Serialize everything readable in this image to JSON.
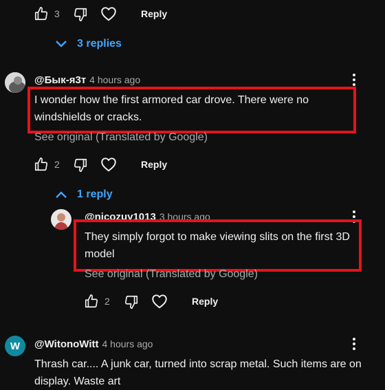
{
  "colors": {
    "background": "#0f0f0f",
    "link": "#3ea6ff",
    "highlight": "#e4131b",
    "avatar_w": "#0f8aa0"
  },
  "top_actions": {
    "like_count": "3",
    "reply_label": "Reply"
  },
  "thread1": {
    "replies_toggle": "3 replies"
  },
  "comment2": {
    "handle": "@Бык-я3т",
    "time": "4 hours ago",
    "text": "I wonder how the first armored car drove. There were no windshields or cracks.",
    "see_original": "See original (Translated by Google)",
    "like_count": "2",
    "reply_label": "Reply",
    "replies_toggle": "1 reply"
  },
  "reply1": {
    "handle": "@nicozuy1013",
    "time": "3 hours ago",
    "text": "They simply forgot to make viewing slits on the first 3D model",
    "see_original": "See original (Translated by Google)",
    "like_count": "2",
    "reply_label": "Reply"
  },
  "comment3": {
    "avatar_letter": "W",
    "handle": "@WitonoWitt",
    "time": "4 hours ago",
    "text": "Thrash car.... A junk car, turned into scrap metal. Such items are on display. Waste art"
  }
}
